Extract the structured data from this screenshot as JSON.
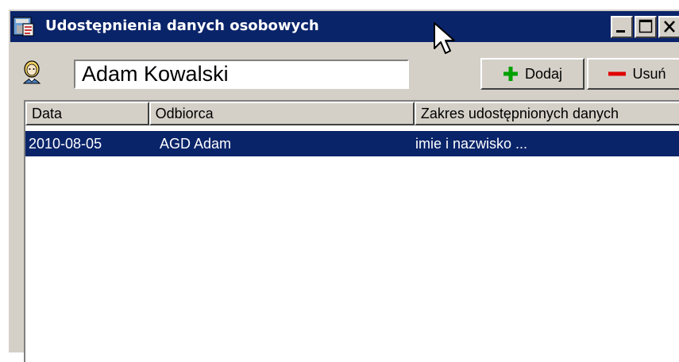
{
  "window": {
    "title": "Udostępnienia danych osobowych",
    "title_icon": "disk-form-icon",
    "controls": [
      "minimize-icon",
      "maximize-icon",
      "close-icon"
    ]
  },
  "person": {
    "icon": "person-icon",
    "name": "Adam Kowalski"
  },
  "toolbar": {
    "add_label": "Dodaj",
    "add_icon": "plus-icon",
    "remove_label": "Usuń",
    "remove_icon": "minus-icon"
  },
  "table": {
    "columns": [
      "Data",
      "Odbiorca",
      "Zakres udostępnionych danych"
    ],
    "rows": [
      {
        "date": "2010-08-05",
        "recipient": "AGD Adam",
        "scope": "imie i nazwisko ...",
        "selected": true
      }
    ]
  },
  "colors": {
    "titlebar": "#0a246a",
    "selection": "#0a246a",
    "face": "#d4d0c8",
    "add_green": "#00a000",
    "remove_red": "#e00000"
  }
}
